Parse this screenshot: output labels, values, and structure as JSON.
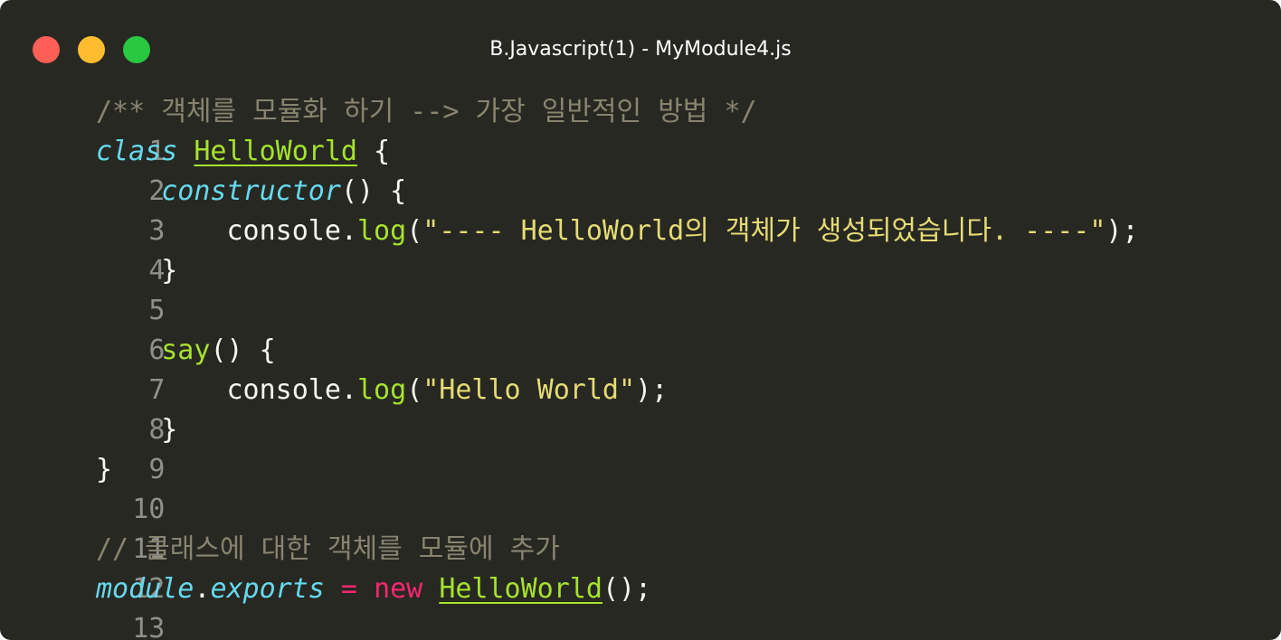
{
  "window": {
    "title": "B.Javascript(1) - MyModule4.js",
    "controls": [
      "close",
      "minimize",
      "maximize"
    ]
  },
  "colors": {
    "background": "#272822",
    "comment": "#88846f",
    "storage": "#66d9ef",
    "entity": "#a6e22e",
    "string": "#e6db74",
    "keyword": "#f92672",
    "foreground": "#f8f8f2"
  },
  "code": {
    "line_numbers": [
      "1",
      "2",
      "3",
      "4",
      "5",
      "6",
      "7",
      "8",
      "9",
      "10",
      "11",
      "12",
      "13"
    ],
    "l1": {
      "comment": "/** 객체를 모듈화 하기 --> 가장 일반적인 방법 */"
    },
    "l2": {
      "class_kw": "class",
      "class_name": "HelloWorld",
      "brace": " {"
    },
    "l3": {
      "indent": "    ",
      "ctor": "constructor",
      "rest": "() {"
    },
    "l4": {
      "indent": "        ",
      "obj": "console.",
      "fn": "log",
      "open": "(",
      "str": "\"---- HelloWorld의 객체가 생성되었습니다. ----\"",
      "close": ");"
    },
    "l5": {
      "indent": "    ",
      "brace": "}"
    },
    "l7": {
      "indent": "    ",
      "fn": "say",
      "rest": "() {"
    },
    "l8": {
      "indent": "        ",
      "obj": "console.",
      "fn": "log",
      "open": "(",
      "str": "\"Hello World\"",
      "close": ");"
    },
    "l9": {
      "indent": "    ",
      "brace": "}"
    },
    "l10": {
      "brace": "}"
    },
    "l12": {
      "comment": "// 클래스에 대한 객체를 모듈에 추가"
    },
    "l13": {
      "module": "module",
      "dot": ".",
      "exports": "exports",
      "eq": " = ",
      "new_kw": "new",
      "space": " ",
      "class_name": "HelloWorld",
      "close": "();"
    }
  }
}
